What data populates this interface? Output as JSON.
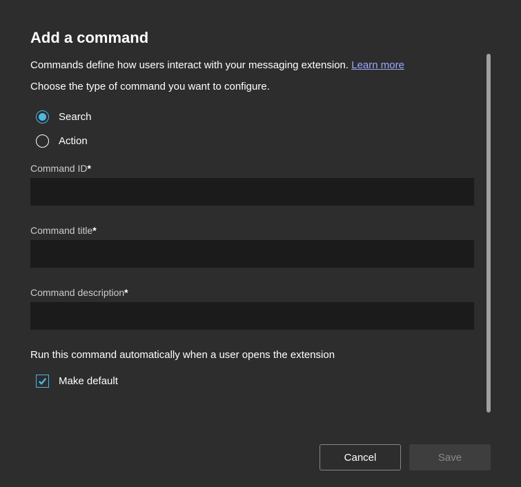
{
  "dialog": {
    "title": "Add a command",
    "description_prefix": "Commands define how users interact with your messaging extension. ",
    "learn_more": "Learn more",
    "subtitle": "Choose the type of command you want to configure."
  },
  "command_type": {
    "options": [
      {
        "value": "search",
        "label": "Search",
        "selected": true
      },
      {
        "value": "action",
        "label": "Action",
        "selected": false
      }
    ]
  },
  "fields": {
    "command_id": {
      "label": "Command ID",
      "required": true,
      "value": ""
    },
    "command_title": {
      "label": "Command title",
      "required": true,
      "value": ""
    },
    "command_description": {
      "label": "Command description",
      "required": true,
      "value": ""
    }
  },
  "auto_run": {
    "section_text": "Run this command automatically when a user opens the extension",
    "checkbox_label": "Make default",
    "checked": true
  },
  "footer": {
    "cancel": "Cancel",
    "save": "Save"
  },
  "required_marker": "*"
}
